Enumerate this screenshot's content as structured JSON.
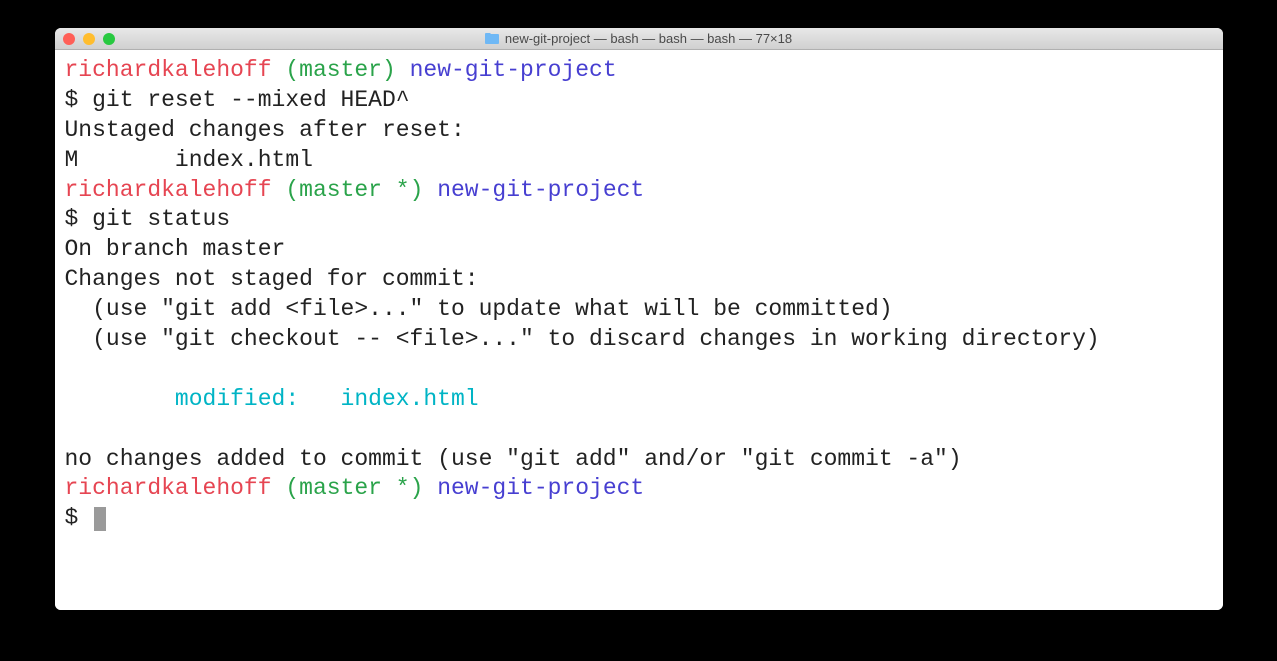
{
  "titlebar": {
    "title": "new-git-project — bash — bash — bash — 77×18"
  },
  "p1": {
    "user": "richardkalehoff",
    "branch": "(master)",
    "project": "new-git-project",
    "symbol": "$ ",
    "cmd": "git reset --mixed HEAD^"
  },
  "out1a": "Unstaged changes after reset:",
  "out1b": "M       index.html",
  "p2": {
    "user": "richardkalehoff",
    "branch": "(master *)",
    "project": "new-git-project",
    "symbol": "$ ",
    "cmd": "git status"
  },
  "status": {
    "branch": "On branch master",
    "header": "Changes not staged for commit:",
    "hint1": "  (use \"git add <file>...\" to update what will be committed)",
    "hint2": "  (use \"git checkout -- <file>...\" to discard changes in working directory)",
    "blank": " ",
    "modified": "        modified:   index.html",
    "blank2": " ",
    "footer": "no changes added to commit (use \"git add\" and/or \"git commit -a\")"
  },
  "p3": {
    "user": "richardkalehoff",
    "branch": "(master *)",
    "project": "new-git-project",
    "symbol": "$ "
  }
}
